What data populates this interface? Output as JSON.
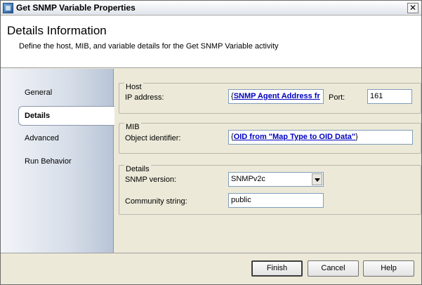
{
  "window": {
    "title": "Get SNMP Variable Properties",
    "close_glyph": "✕"
  },
  "header": {
    "title": "Details Information",
    "subtitle": "Define the host, MIB, and variable details for the Get SNMP Variable activity"
  },
  "sidebar": {
    "items": [
      {
        "label": "General"
      },
      {
        "label": "Details"
      },
      {
        "label": "Advanced"
      },
      {
        "label": "Run Behavior"
      }
    ]
  },
  "host": {
    "legend": "Host",
    "ip_label": "IP address:",
    "ip_brace_open": "{",
    "ip_value": "SNMP Agent Address fr",
    "port_label": "Port:",
    "port_value": "161"
  },
  "mib": {
    "legend": "MIB",
    "oid_label": "Object identifier:",
    "oid_brace_open": "{",
    "oid_value": "OID from \"Map Type to OID Data\"",
    "oid_brace_close": "}"
  },
  "details": {
    "legend": "Details",
    "version_label": "SNMP version:",
    "version_value": "SNMPv2c",
    "community_label": "Community string:",
    "community_value": "public"
  },
  "buttons": {
    "finish": "Finish",
    "cancel": "Cancel",
    "help": "Help"
  }
}
